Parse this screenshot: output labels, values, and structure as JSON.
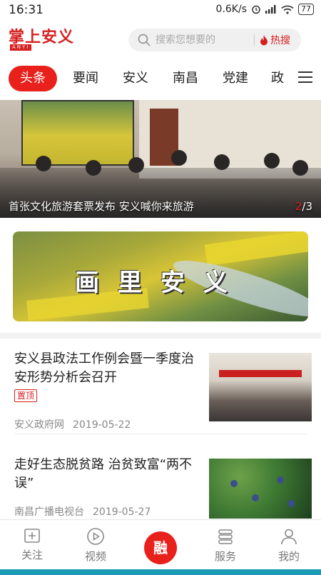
{
  "status_bar": {
    "time": "16:31",
    "network_speed": "0.6K/s",
    "battery": "77",
    "icons": [
      "alarm-icon",
      "signal-icon",
      "wifi-icon",
      "battery-icon"
    ]
  },
  "header": {
    "logo_text": "掌上安义",
    "logo_sub": "ANYI",
    "search_placeholder": "搜索您想要的",
    "hot_search_label": "热搜"
  },
  "tabs": [
    {
      "label": "头条",
      "active": true
    },
    {
      "label": "要闻",
      "active": false
    },
    {
      "label": "安义",
      "active": false
    },
    {
      "label": "南昌",
      "active": false
    },
    {
      "label": "党建",
      "active": false
    },
    {
      "label": "政",
      "active": false
    }
  ],
  "banner": {
    "caption": "首张文化旅游套票发布 安义喊你来旅游",
    "pager_current": "2",
    "pager_total": "/3"
  },
  "promo": {
    "title": "画里安义"
  },
  "news": [
    {
      "title": "安义县政法工作例会暨一季度治安形势分析会召开",
      "tag": "置顶",
      "source": "安义政府网",
      "date": "2019-05-22"
    },
    {
      "title": "走好生态脱贫路 治贫致富“两不误”",
      "source": "南昌广播电视台",
      "date": "2019-05-27"
    }
  ],
  "bottom_nav": [
    {
      "label": "关注",
      "icon": "add-follow-icon"
    },
    {
      "label": "视频",
      "icon": "play-icon"
    },
    {
      "label": "融",
      "icon": "center-button"
    },
    {
      "label": "服务",
      "icon": "service-list-icon"
    },
    {
      "label": "我的",
      "icon": "user-icon"
    }
  ],
  "colors": {
    "accent": "#e8211d",
    "text": "#222222",
    "muted": "#888888"
  }
}
